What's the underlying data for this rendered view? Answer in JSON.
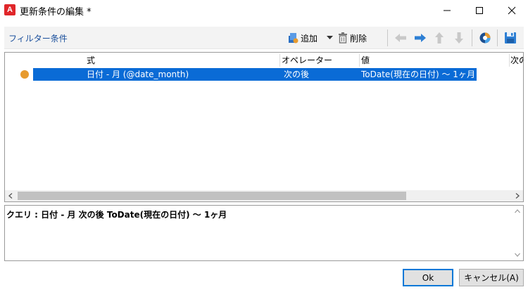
{
  "window": {
    "title": "更新条件の編集 *",
    "app_logo_letter": "A"
  },
  "toolbar": {
    "filter_label": "フィルター条件",
    "add_label": "追加",
    "delete_label": "削除"
  },
  "grid": {
    "columns": [
      "式",
      "オペレーター",
      "値",
      "次の"
    ],
    "rows": [
      {
        "expression": "日付 - 月 (@date_month)",
        "operator": "次の後",
        "value": "ToDate(現在の日付) 〜 1ヶ月"
      }
    ]
  },
  "query": {
    "text": "クエリ : 日付 - 月 次の後 ToDate(現在の日付) 〜 1ヶ月"
  },
  "buttons": {
    "ok_label": "Ok",
    "cancel_label": "キャンセル(A)"
  },
  "colors": {
    "selection": "#0a6bd6",
    "link_blue": "#1a4f9c",
    "bullet": "#e79a2e",
    "logo_red": "#e0262a"
  }
}
